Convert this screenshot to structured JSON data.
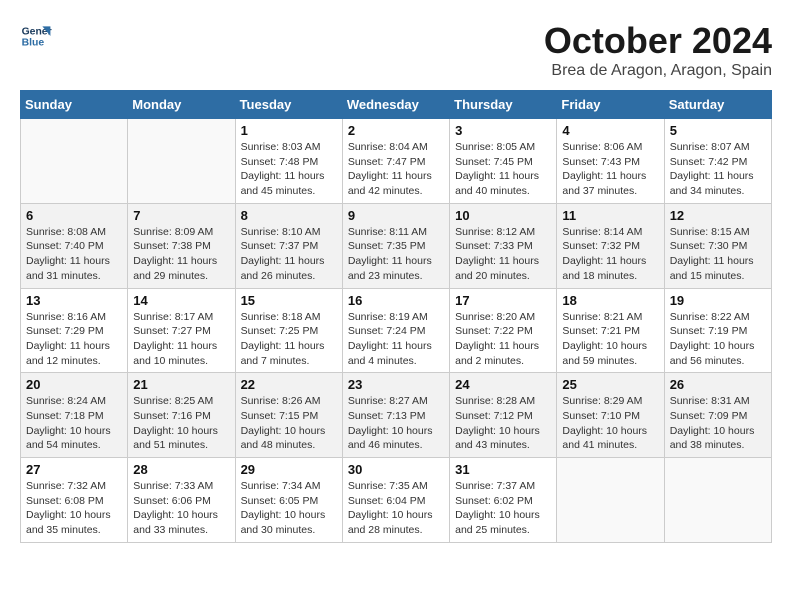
{
  "logo": {
    "line1": "General",
    "line2": "Blue"
  },
  "title": "October 2024",
  "location": "Brea de Aragon, Aragon, Spain",
  "days_of_week": [
    "Sunday",
    "Monday",
    "Tuesday",
    "Wednesday",
    "Thursday",
    "Friday",
    "Saturday"
  ],
  "weeks": [
    [
      {
        "day": "",
        "info": ""
      },
      {
        "day": "",
        "info": ""
      },
      {
        "day": "1",
        "info": "Sunrise: 8:03 AM\nSunset: 7:48 PM\nDaylight: 11 hours and 45 minutes."
      },
      {
        "day": "2",
        "info": "Sunrise: 8:04 AM\nSunset: 7:47 PM\nDaylight: 11 hours and 42 minutes."
      },
      {
        "day": "3",
        "info": "Sunrise: 8:05 AM\nSunset: 7:45 PM\nDaylight: 11 hours and 40 minutes."
      },
      {
        "day": "4",
        "info": "Sunrise: 8:06 AM\nSunset: 7:43 PM\nDaylight: 11 hours and 37 minutes."
      },
      {
        "day": "5",
        "info": "Sunrise: 8:07 AM\nSunset: 7:42 PM\nDaylight: 11 hours and 34 minutes."
      }
    ],
    [
      {
        "day": "6",
        "info": "Sunrise: 8:08 AM\nSunset: 7:40 PM\nDaylight: 11 hours and 31 minutes."
      },
      {
        "day": "7",
        "info": "Sunrise: 8:09 AM\nSunset: 7:38 PM\nDaylight: 11 hours and 29 minutes."
      },
      {
        "day": "8",
        "info": "Sunrise: 8:10 AM\nSunset: 7:37 PM\nDaylight: 11 hours and 26 minutes."
      },
      {
        "day": "9",
        "info": "Sunrise: 8:11 AM\nSunset: 7:35 PM\nDaylight: 11 hours and 23 minutes."
      },
      {
        "day": "10",
        "info": "Sunrise: 8:12 AM\nSunset: 7:33 PM\nDaylight: 11 hours and 20 minutes."
      },
      {
        "day": "11",
        "info": "Sunrise: 8:14 AM\nSunset: 7:32 PM\nDaylight: 11 hours and 18 minutes."
      },
      {
        "day": "12",
        "info": "Sunrise: 8:15 AM\nSunset: 7:30 PM\nDaylight: 11 hours and 15 minutes."
      }
    ],
    [
      {
        "day": "13",
        "info": "Sunrise: 8:16 AM\nSunset: 7:29 PM\nDaylight: 11 hours and 12 minutes."
      },
      {
        "day": "14",
        "info": "Sunrise: 8:17 AM\nSunset: 7:27 PM\nDaylight: 11 hours and 10 minutes."
      },
      {
        "day": "15",
        "info": "Sunrise: 8:18 AM\nSunset: 7:25 PM\nDaylight: 11 hours and 7 minutes."
      },
      {
        "day": "16",
        "info": "Sunrise: 8:19 AM\nSunset: 7:24 PM\nDaylight: 11 hours and 4 minutes."
      },
      {
        "day": "17",
        "info": "Sunrise: 8:20 AM\nSunset: 7:22 PM\nDaylight: 11 hours and 2 minutes."
      },
      {
        "day": "18",
        "info": "Sunrise: 8:21 AM\nSunset: 7:21 PM\nDaylight: 10 hours and 59 minutes."
      },
      {
        "day": "19",
        "info": "Sunrise: 8:22 AM\nSunset: 7:19 PM\nDaylight: 10 hours and 56 minutes."
      }
    ],
    [
      {
        "day": "20",
        "info": "Sunrise: 8:24 AM\nSunset: 7:18 PM\nDaylight: 10 hours and 54 minutes."
      },
      {
        "day": "21",
        "info": "Sunrise: 8:25 AM\nSunset: 7:16 PM\nDaylight: 10 hours and 51 minutes."
      },
      {
        "day": "22",
        "info": "Sunrise: 8:26 AM\nSunset: 7:15 PM\nDaylight: 10 hours and 48 minutes."
      },
      {
        "day": "23",
        "info": "Sunrise: 8:27 AM\nSunset: 7:13 PM\nDaylight: 10 hours and 46 minutes."
      },
      {
        "day": "24",
        "info": "Sunrise: 8:28 AM\nSunset: 7:12 PM\nDaylight: 10 hours and 43 minutes."
      },
      {
        "day": "25",
        "info": "Sunrise: 8:29 AM\nSunset: 7:10 PM\nDaylight: 10 hours and 41 minutes."
      },
      {
        "day": "26",
        "info": "Sunrise: 8:31 AM\nSunset: 7:09 PM\nDaylight: 10 hours and 38 minutes."
      }
    ],
    [
      {
        "day": "27",
        "info": "Sunrise: 7:32 AM\nSunset: 6:08 PM\nDaylight: 10 hours and 35 minutes."
      },
      {
        "day": "28",
        "info": "Sunrise: 7:33 AM\nSunset: 6:06 PM\nDaylight: 10 hours and 33 minutes."
      },
      {
        "day": "29",
        "info": "Sunrise: 7:34 AM\nSunset: 6:05 PM\nDaylight: 10 hours and 30 minutes."
      },
      {
        "day": "30",
        "info": "Sunrise: 7:35 AM\nSunset: 6:04 PM\nDaylight: 10 hours and 28 minutes."
      },
      {
        "day": "31",
        "info": "Sunrise: 7:37 AM\nSunset: 6:02 PM\nDaylight: 10 hours and 25 minutes."
      },
      {
        "day": "",
        "info": ""
      },
      {
        "day": "",
        "info": ""
      }
    ]
  ]
}
